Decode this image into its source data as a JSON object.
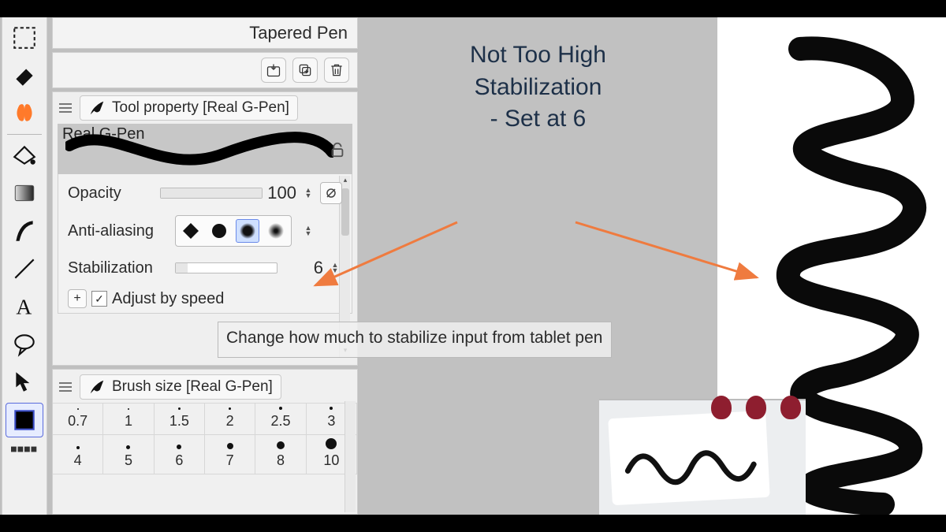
{
  "brush_header": {
    "name": "Tapered Pen"
  },
  "tool_property": {
    "title": "Tool property [Real G-Pen]",
    "preview_label": "Real G-Pen",
    "opacity": {
      "label": "Opacity",
      "value": "100"
    },
    "anti_aliasing": {
      "label": "Anti-aliasing"
    },
    "stabilization": {
      "label": "Stabilization",
      "value": "6"
    },
    "adjust": {
      "label": "Adjust by speed"
    },
    "tooltip": "Change how much to stabilize input from tablet pen"
  },
  "brush_size": {
    "title": "Brush size [Real G-Pen]",
    "row1": [
      "0.7",
      "1",
      "1.5",
      "2",
      "2.5",
      "3"
    ],
    "row2": [
      "4",
      "5",
      "6",
      "7",
      "8",
      "10"
    ]
  },
  "overlay": {
    "title": "Not Too High\nStabilization\n- Set at 6"
  },
  "brush_dot_sizes_row1": [
    2,
    2,
    3,
    3,
    4,
    4
  ],
  "brush_dot_sizes_row2": [
    4,
    5,
    6,
    8,
    10,
    14
  ]
}
